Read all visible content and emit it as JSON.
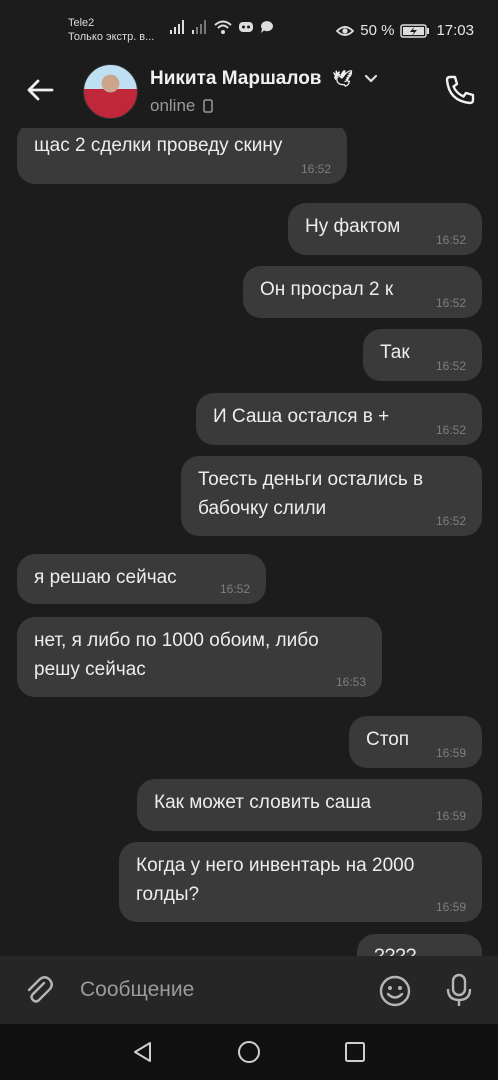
{
  "status_bar": {
    "carrier_line1": "Tele2",
    "carrier_line2": "Только экстр. в...",
    "battery": "50 %",
    "time": "17:03"
  },
  "header": {
    "contact_name": "Никита Маршалов",
    "presence": "online",
    "icons": [
      "back-arrow-icon",
      "dove-emoji-icon",
      "chevron-down-icon",
      "phone-device-icon",
      "phone-call-icon"
    ]
  },
  "messages": [
    {
      "side": "in",
      "text": "щас 2 сделки проведу скину",
      "time": "16:52"
    },
    {
      "side": "out",
      "text": "Ну фактом",
      "time": "16:52"
    },
    {
      "side": "out",
      "text": "Он просрал 2 к",
      "time": "16:52"
    },
    {
      "side": "out",
      "text": "Так",
      "time": "16:52"
    },
    {
      "side": "out",
      "text": "И Саша остался в +",
      "time": "16:52"
    },
    {
      "side": "out",
      "text": "Тоесть деньги остались в бабочку слили",
      "time": "16:52"
    },
    {
      "side": "in",
      "text": "я решаю сейчас",
      "time": "16:52"
    },
    {
      "side": "in",
      "text": "нет, я либо по 1000 обоим, либо решу сейчас",
      "time": "16:53"
    },
    {
      "side": "out",
      "text": "Стоп",
      "time": "16:59"
    },
    {
      "side": "out",
      "text": "Как может словить саша",
      "time": "16:59"
    },
    {
      "side": "out",
      "text": "Когда у него инвентарь на 2000 голды?",
      "time": "16:59"
    },
    {
      "side": "out",
      "text": "????",
      "time": ""
    }
  ],
  "composer": {
    "placeholder": "Сообщение",
    "icons": [
      "paperclip-icon",
      "emoji-icon",
      "microphone-icon"
    ]
  },
  "navbar": {
    "icons": [
      "nav-back-icon",
      "nav-home-icon",
      "nav-recents-icon"
    ]
  },
  "colors": {
    "background": "#1c1c1c",
    "bubble": "#3a3a3a",
    "composer": "#262626",
    "navbar": "#111111"
  }
}
